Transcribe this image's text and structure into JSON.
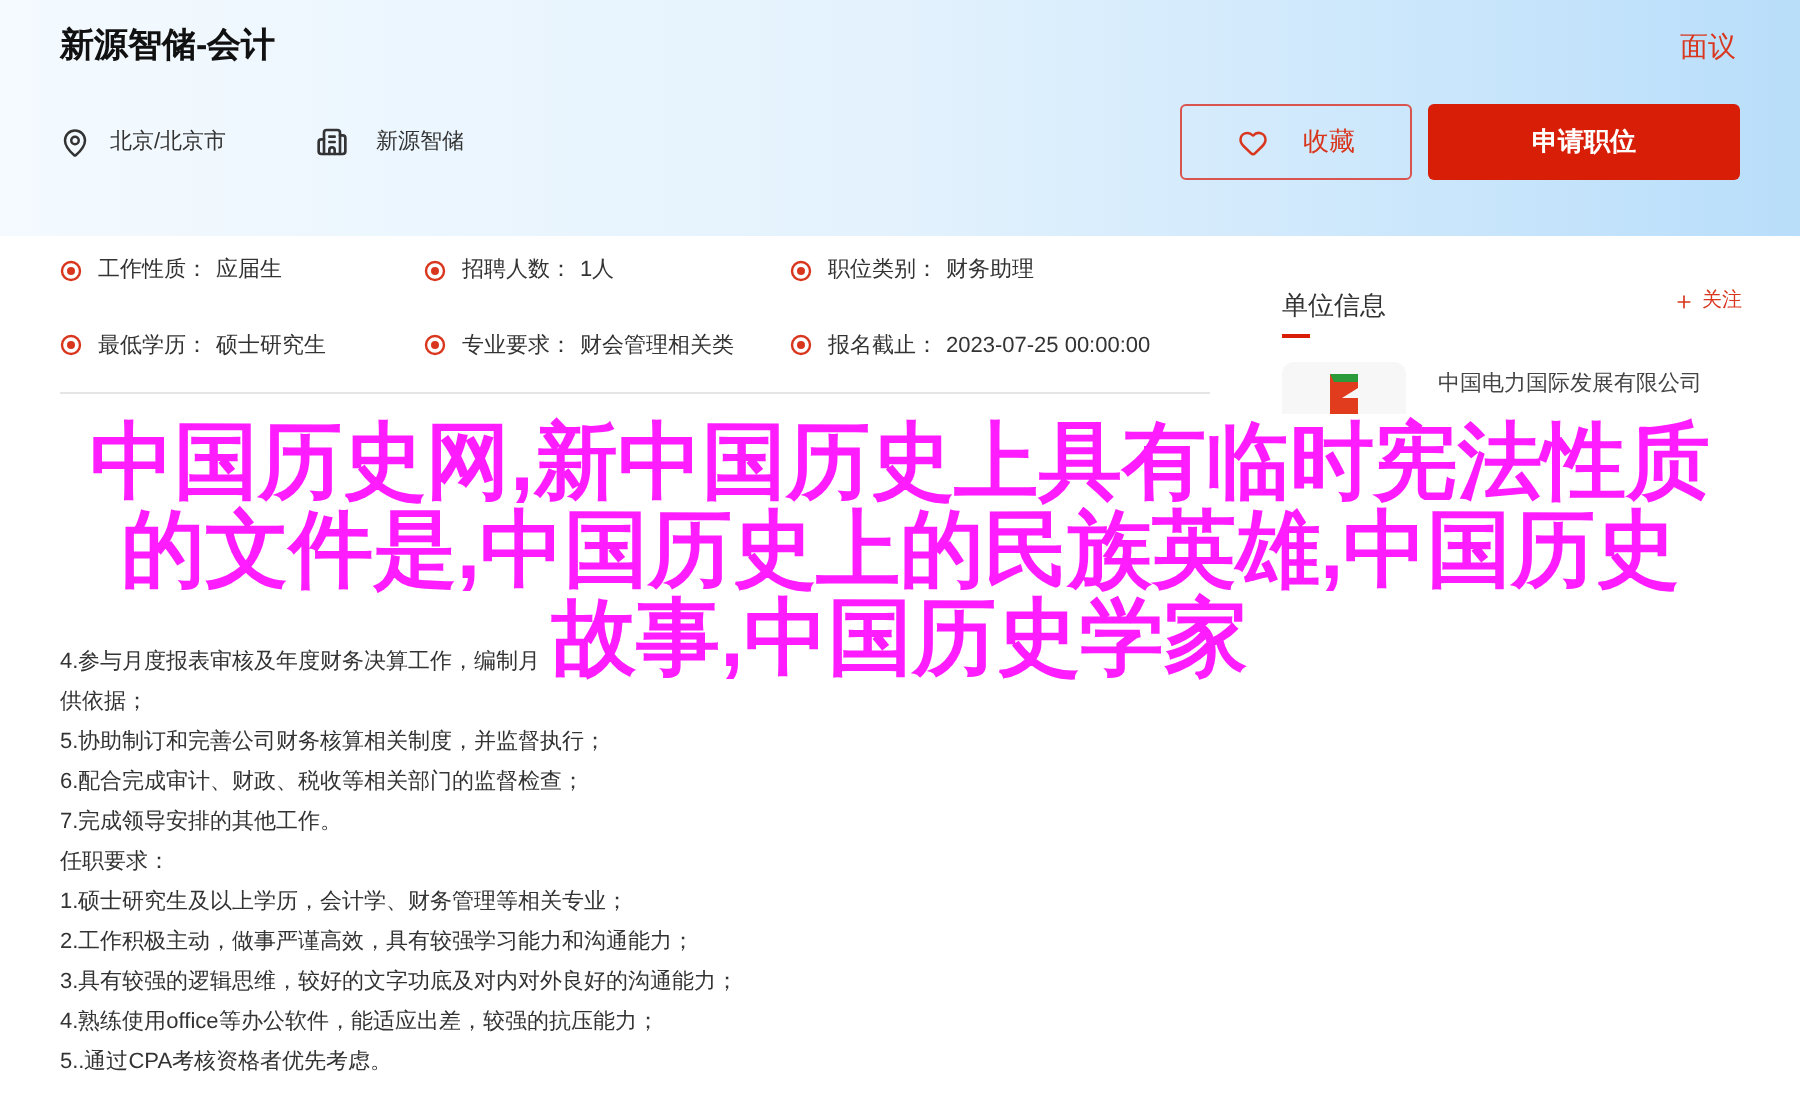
{
  "job": {
    "title": "新源智储-会计",
    "salary": "面议",
    "location": "北京/北京市",
    "company": "新源智储"
  },
  "actions": {
    "favorite": "收藏",
    "apply": "申请职位"
  },
  "details": [
    {
      "label": "工作性质：",
      "value": "应届生"
    },
    {
      "label": "招聘人数：",
      "value": "1人"
    },
    {
      "label": "职位类别：",
      "value": "财务助理"
    },
    {
      "label": "最低学历：",
      "value": "硕士研究生"
    },
    {
      "label": "专业要求：",
      "value": "财会管理相关类"
    },
    {
      "label": "报名截止：",
      "value": "2023-07-25 00:00:00"
    }
  ],
  "description": {
    "lines": [
      "4.参与月度报表审核及年度财务决算工作，编制月",
      "供依据；",
      "5.协助制订和完善公司财务核算相关制度，并监督执行；",
      "6.配合完成审计、财政、税收等相关部门的监督检查；",
      "7.完成领导安排的其他工作。",
      "任职要求：",
      "1.硕士研究生及以上学历，会计学、财务管理等相关专业；",
      "2.工作积极主动，做事严谨高效，具有较强学习能力和沟通能力；",
      "3.具有较强的逻辑思维，较好的文字功底及对内对外良好的沟通能力；",
      "4.熟练使用office等办公软件，能适应出差，较强的抗压能力；",
      "5..通过CPA考核资格者优先考虑。"
    ]
  },
  "sidebar": {
    "title": "单位信息",
    "follow": "关注",
    "company_name": "中国电力国际发展有限公司"
  },
  "overlay_title": {
    "lines": [
      "中国历史网,新中国历史上具有临时宪法性质",
      "的文件是,中国历史上的民族英雄,中国历史",
      "故事,中国历史学家"
    ]
  }
}
